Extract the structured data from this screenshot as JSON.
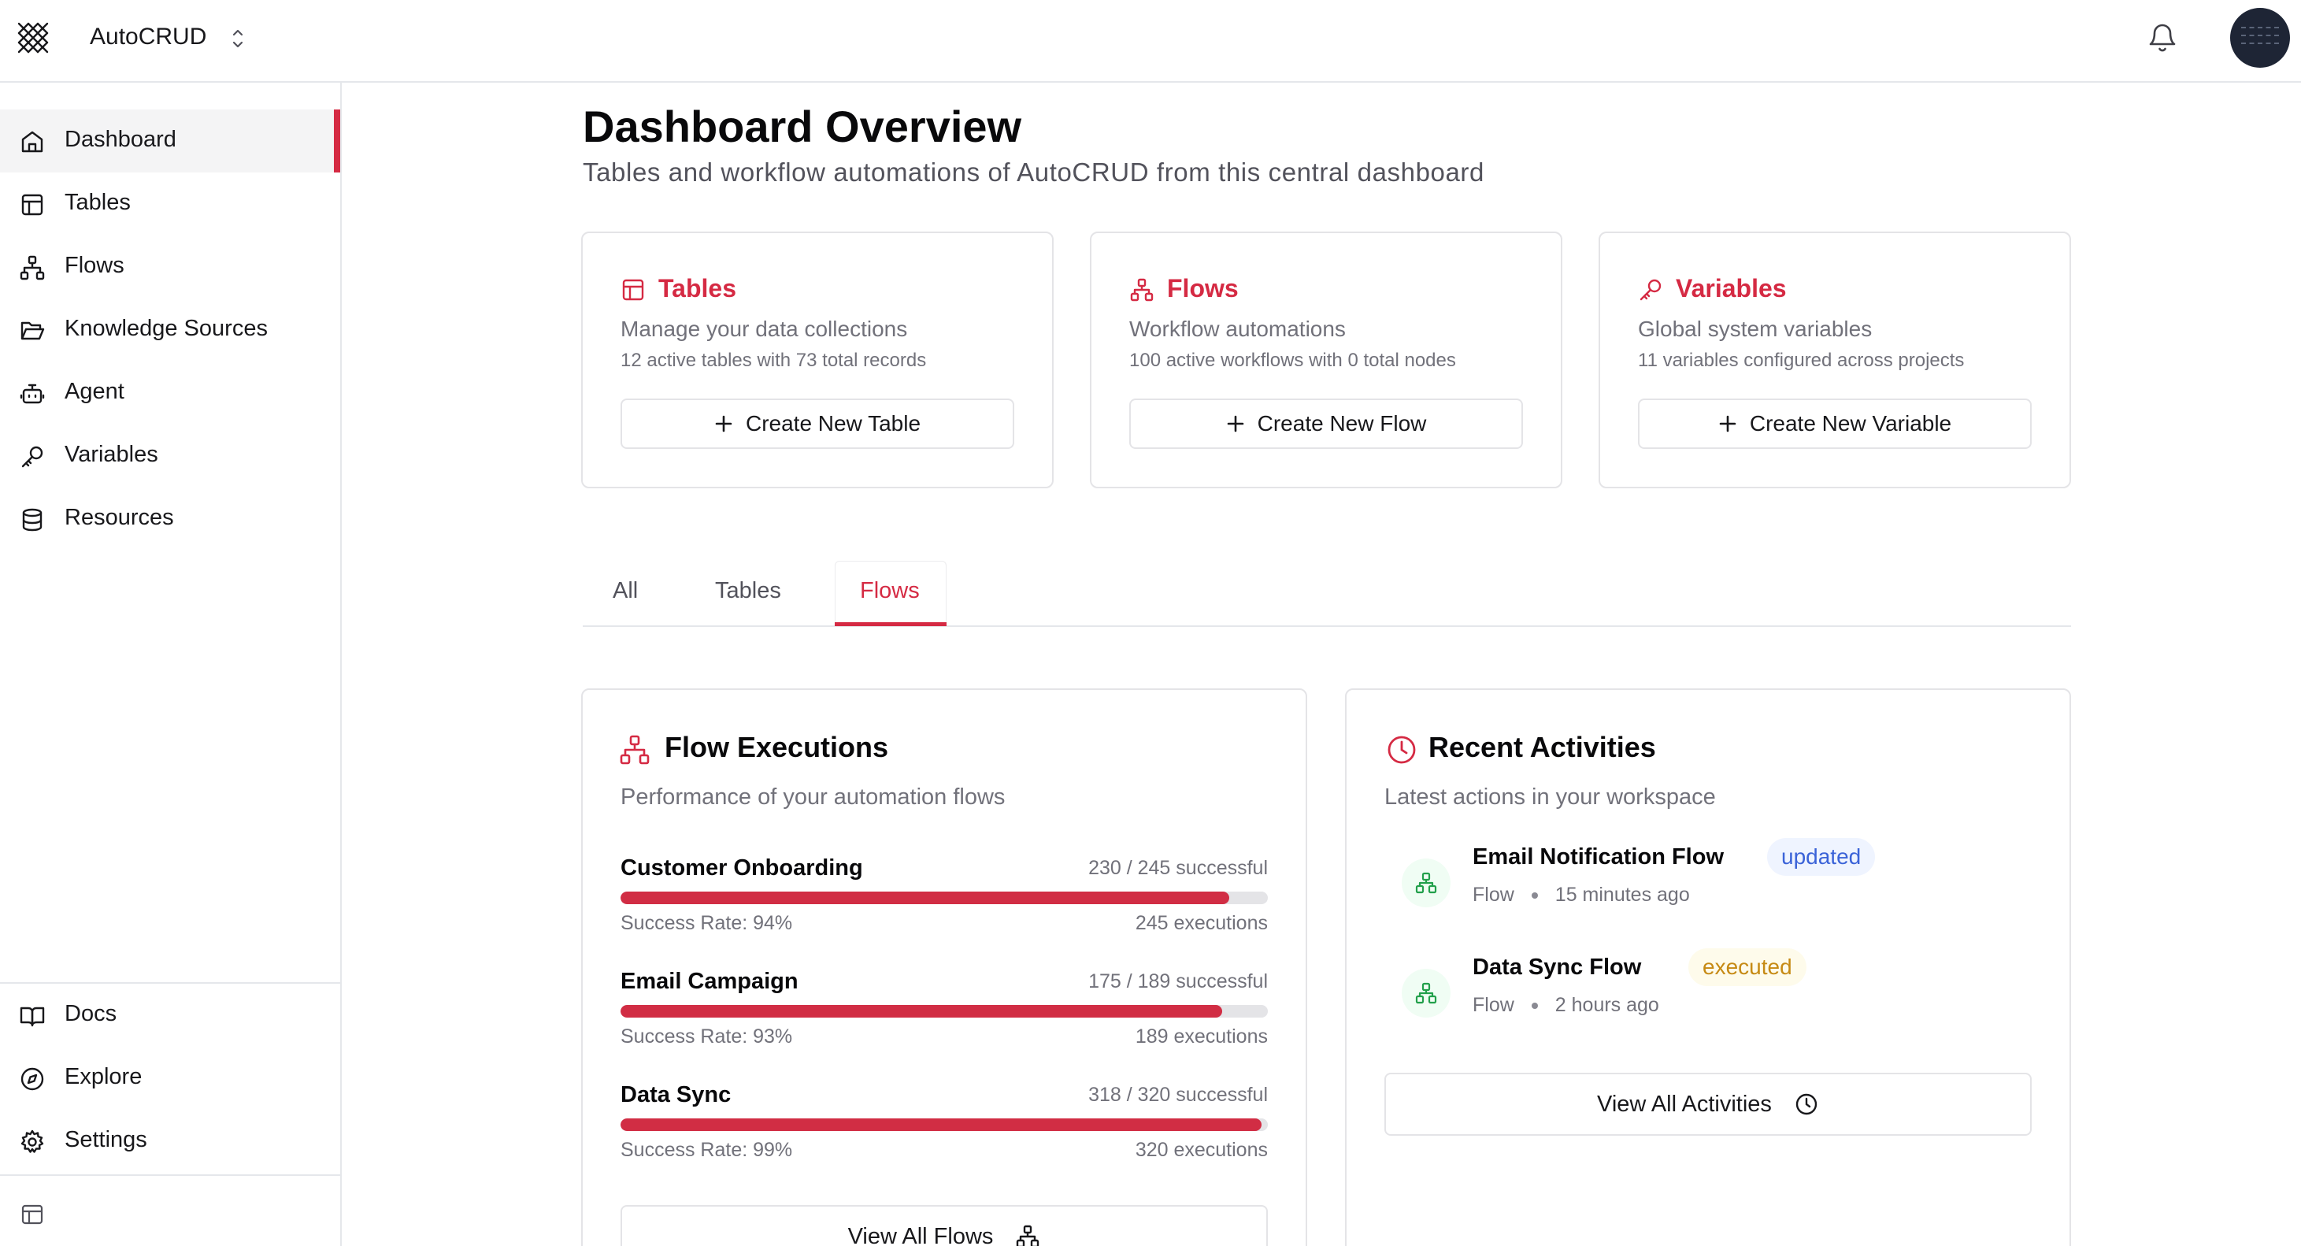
{
  "app": {
    "name": "AutoCRUD"
  },
  "sidebar": {
    "items": [
      {
        "label": "Dashboard",
        "icon": "home-icon",
        "active": true
      },
      {
        "label": "Tables",
        "icon": "table-icon"
      },
      {
        "label": "Flows",
        "icon": "flow-icon"
      },
      {
        "label": "Knowledge Sources",
        "icon": "folder-open-icon"
      },
      {
        "label": "Agent",
        "icon": "bot-icon"
      },
      {
        "label": "Variables",
        "icon": "key-icon"
      },
      {
        "label": "Resources",
        "icon": "database-icon"
      }
    ],
    "footer": [
      {
        "label": "Docs",
        "icon": "book-icon"
      },
      {
        "label": "Explore",
        "icon": "compass-icon"
      },
      {
        "label": "Settings",
        "icon": "gear-icon"
      }
    ]
  },
  "main": {
    "title": "Dashboard Overview",
    "subtitle": "Tables and workflow automations of AutoCRUD from this central dashboard",
    "cards": [
      {
        "title": "Tables",
        "description": "Manage your data collections",
        "meta": "12 active tables with 73 total records",
        "button": "Create New Table"
      },
      {
        "title": "Flows",
        "description": "Workflow automations",
        "meta": "100 active workflows with 0 total nodes",
        "button": "Create New Flow"
      },
      {
        "title": "Variables",
        "description": "Global system variables",
        "meta": "11 variables configured across projects",
        "button": "Create New Variable"
      }
    ],
    "tabs": [
      {
        "label": "All"
      },
      {
        "label": "Tables"
      },
      {
        "label": "Flows",
        "active": true
      }
    ]
  },
  "flow_executions": {
    "title": "Flow Executions",
    "description": "Performance of your automation flows",
    "flows": [
      {
        "name": "Customer Onboarding",
        "count": "230 / 245 successful",
        "rate_text": "Success Rate: 94%",
        "executions": "245 executions",
        "rate": 0.94
      },
      {
        "name": "Email Campaign",
        "count": "175 / 189 successful",
        "rate_text": "Success Rate: 93%",
        "executions": "189 executions",
        "rate": 0.93
      },
      {
        "name": "Data Sync",
        "count": "318 / 320 successful",
        "rate_text": "Success Rate: 99%",
        "executions": "320 executions",
        "rate": 0.99
      }
    ],
    "button": "View All Flows"
  },
  "recent_activities": {
    "title": "Recent Activities",
    "description": "Latest actions in your workspace",
    "items": [
      {
        "title": "Email Notification Flow",
        "badge": "updated",
        "type": "Flow",
        "time": "15 minutes ago"
      },
      {
        "title": "Data Sync Flow",
        "badge": "executed",
        "type": "Flow",
        "time": "2 hours ago"
      }
    ],
    "button": "View All Activities"
  },
  "colors": {
    "accent": "#d52a43",
    "badge_blue": "#3b63d8",
    "badge_amber": "#c68a14",
    "activity_icon": "#22a04b"
  }
}
